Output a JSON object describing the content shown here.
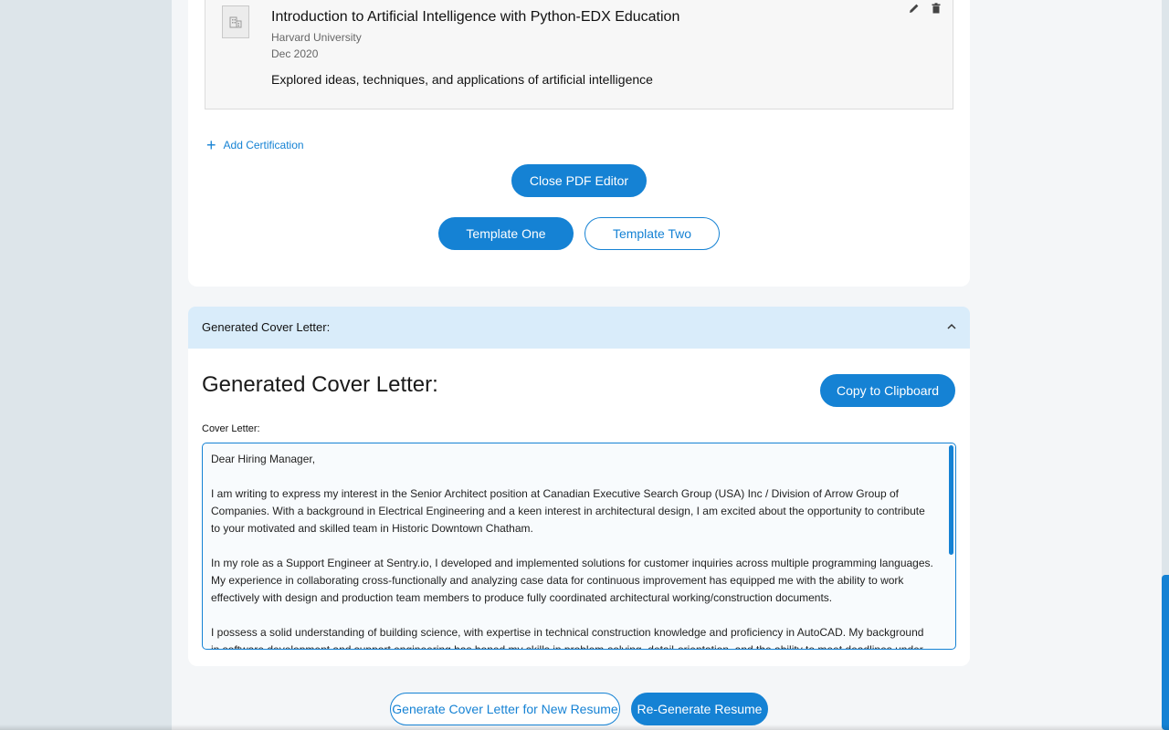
{
  "certification": {
    "title": "Introduction to Artificial Intelligence with Python-EDX Education",
    "organization": "Harvard University",
    "date": "Dec 2020",
    "description": "Explored ideas, techniques, and applications of artificial intelligence"
  },
  "actions": {
    "add_certification": "Add Certification",
    "close_pdf_editor": "Close PDF Editor",
    "template_one": "Template One",
    "template_two": "Template Two"
  },
  "accordion": {
    "title": "Generated Cover Letter:"
  },
  "cover_letter": {
    "heading": "Generated Cover Letter:",
    "copy_button": "Copy to Clipboard",
    "field_label": "Cover Letter:",
    "paragraphs": [
      "Dear Hiring Manager,",
      "I am writing to express my interest in the Senior Architect position at Canadian Executive Search Group (USA) Inc / Division of Arrow Group of Companies. With a background in Electrical Engineering and a keen interest in architectural design, I am excited about the opportunity to contribute to your motivated and skilled team in Historic Downtown Chatham.",
      "In my role as a Support Engineer at Sentry.io, I developed and implemented solutions for customer inquiries across multiple programming languages. My experience in collaborating cross-functionally and analyzing case data for continuous improvement has equipped me with the ability to work effectively with design and production team members to produce fully coordinated architectural working/construction documents.",
      "I possess a solid understanding of building science, with expertise in technical construction knowledge and proficiency in AutoCAD. My background in software development and support engineering has honed my skills in problem-solving, detail-orientation, and the ability to meet deadlines under pressure."
    ]
  },
  "footer": {
    "generate_new": "Generate Cover Letter for New Resume",
    "regenerate": "Re-Generate Resume"
  },
  "colors": {
    "accent": "#1582d4",
    "accordion_bg": "#d9ecfa",
    "page_bg": "#dde5ea"
  }
}
